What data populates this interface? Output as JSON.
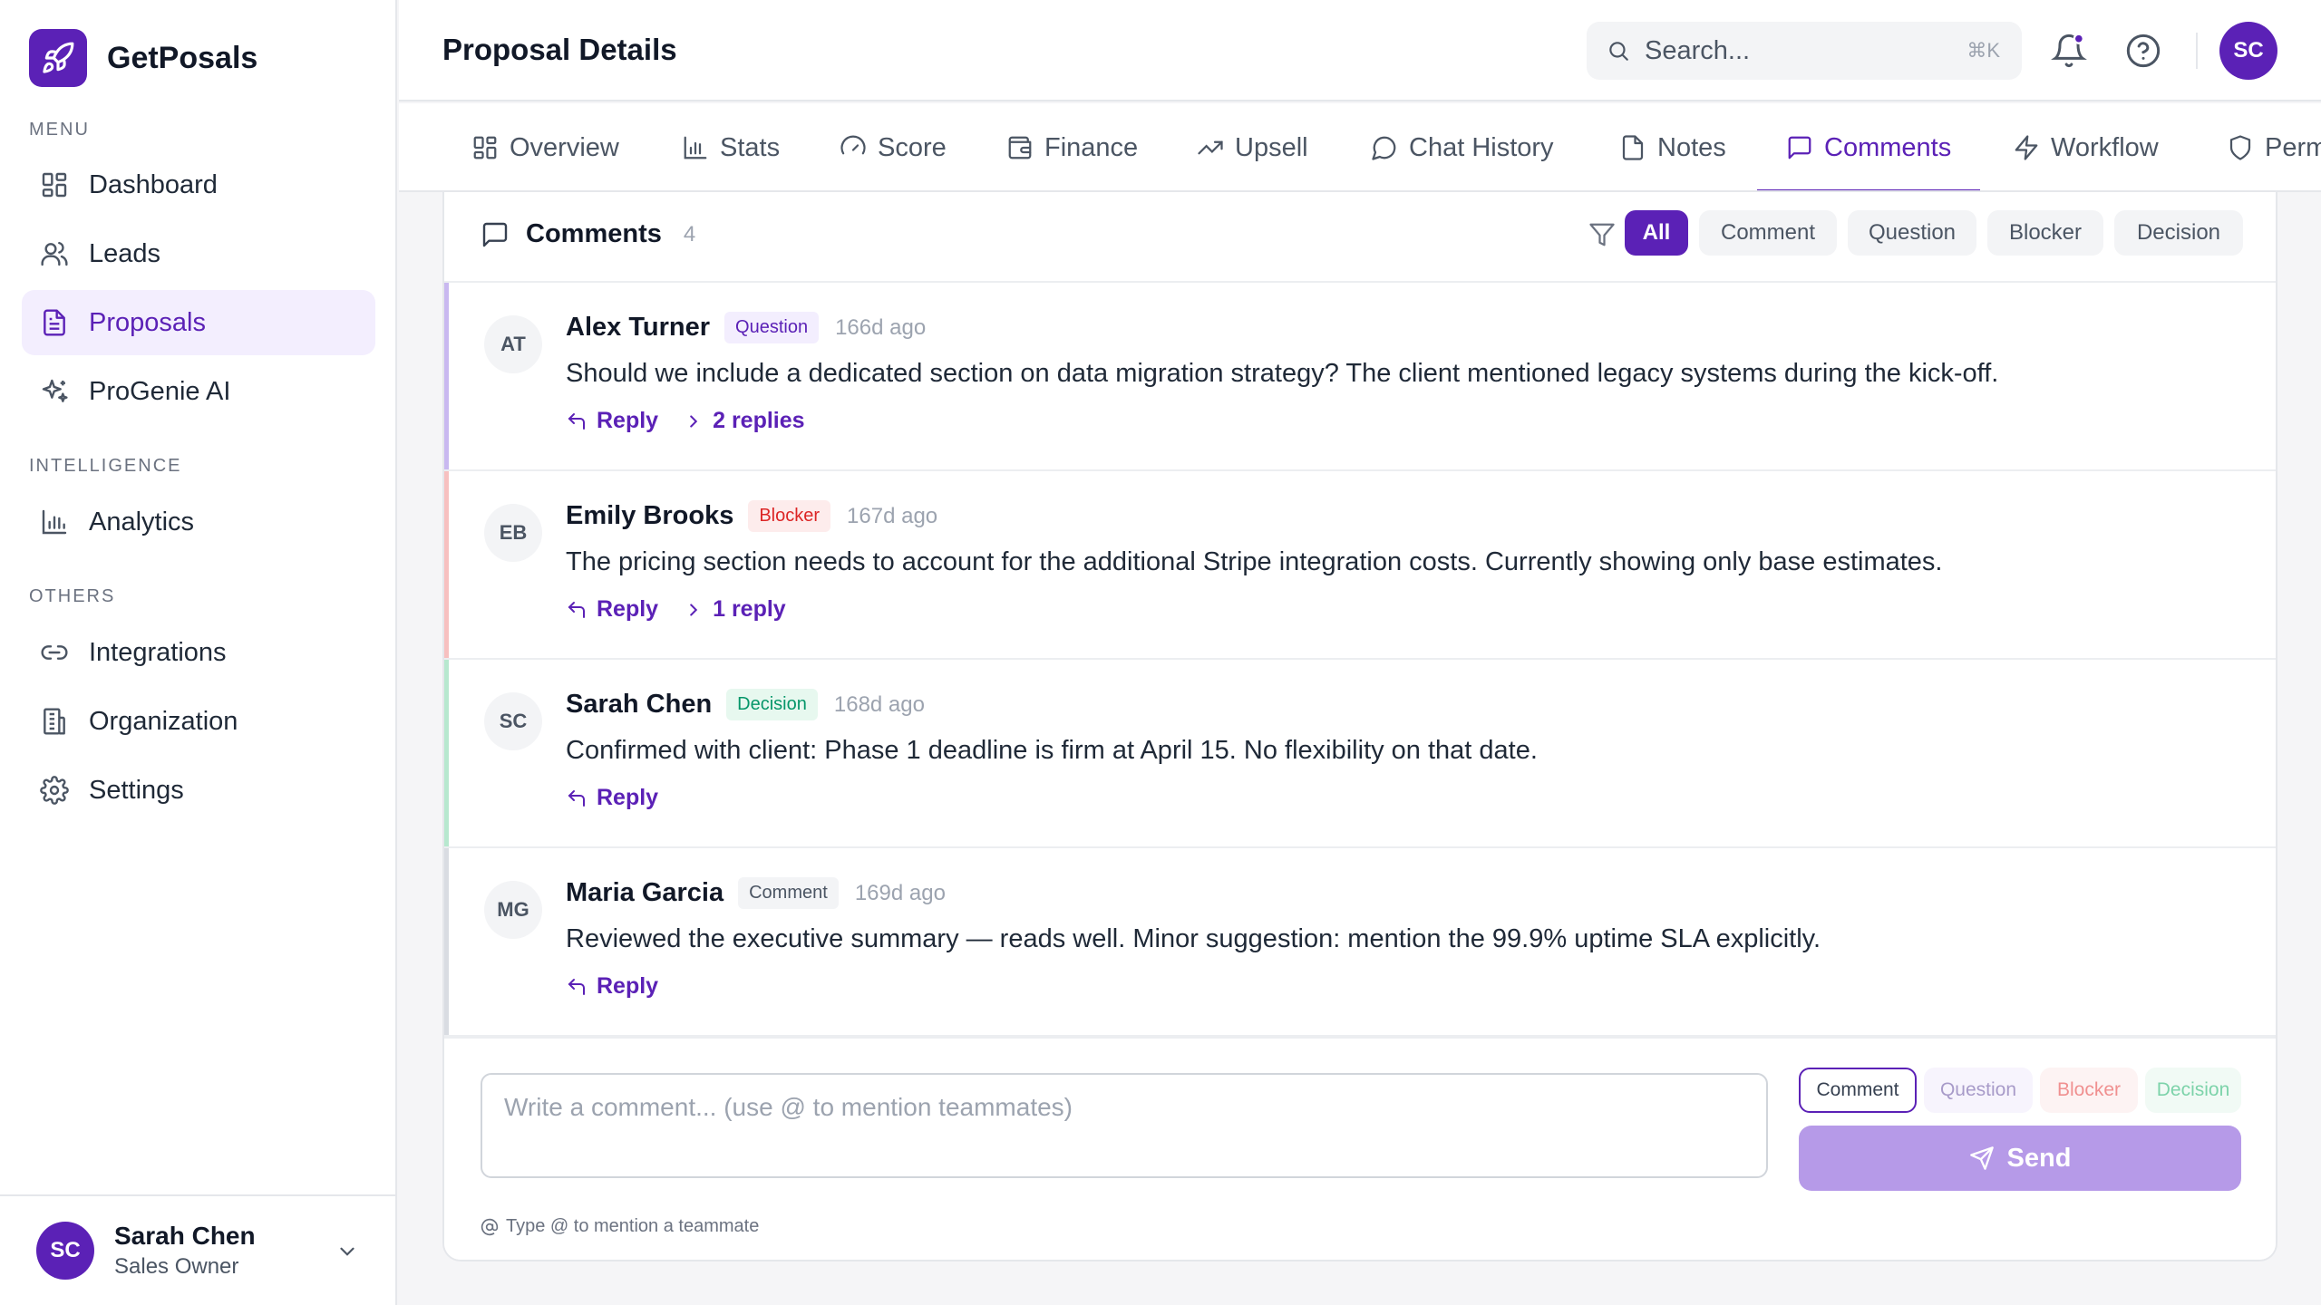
{
  "brand": {
    "name": "GetPosals"
  },
  "sidebar": {
    "sections": {
      "menu": "MENU",
      "intelligence": "INTELLIGENCE",
      "others": "OTHERS"
    },
    "items": [
      {
        "label": "Dashboard",
        "icon": "grid-icon"
      },
      {
        "label": "Leads",
        "icon": "users-icon"
      },
      {
        "label": "Proposals",
        "icon": "document-icon",
        "active": true
      },
      {
        "label": "ProGenie AI",
        "icon": "sparkles-icon"
      },
      {
        "label": "Analytics",
        "icon": "bar-chart-icon"
      },
      {
        "label": "Integrations",
        "icon": "link-icon"
      },
      {
        "label": "Organization",
        "icon": "building-icon"
      },
      {
        "label": "Settings",
        "icon": "gear-icon"
      }
    ],
    "user": {
      "initials": "SC",
      "name": "Sarah Chen",
      "role": "Sales Owner"
    }
  },
  "header": {
    "title": "Proposal Details",
    "search_placeholder": "Search...",
    "search_shortcut": "⌘K",
    "avatar_initials": "SC"
  },
  "tabs": [
    {
      "label": "Overview"
    },
    {
      "label": "Stats"
    },
    {
      "label": "Score"
    },
    {
      "label": "Finance"
    },
    {
      "label": "Upsell"
    },
    {
      "label": "Chat History"
    },
    {
      "label": "Notes"
    },
    {
      "label": "Comments",
      "active": true
    },
    {
      "label": "Workflow"
    },
    {
      "label": "Permissions"
    }
  ],
  "comments_panel": {
    "title": "Comments",
    "count": "4",
    "filters": [
      "All",
      "Comment",
      "Question",
      "Blocker",
      "Decision"
    ],
    "active_filter": "All",
    "items": [
      {
        "initials": "AT",
        "author": "Alex Turner",
        "type": "Question",
        "time": "166d ago",
        "text": "Should we include a dedicated section on data migration strategy? The client mentioned legacy systems during the kick-off.",
        "reply_label": "Reply",
        "replies_label": "2 replies"
      },
      {
        "initials": "EB",
        "author": "Emily Brooks",
        "type": "Blocker",
        "time": "167d ago",
        "text": "The pricing section needs to account for the additional Stripe integration costs. Currently showing only base estimates.",
        "reply_label": "Reply",
        "replies_label": "1 reply"
      },
      {
        "initials": "SC",
        "author": "Sarah Chen",
        "type": "Decision",
        "time": "168d ago",
        "text": "Confirmed with client: Phase 1 deadline is firm at April 15. No flexibility on that date.",
        "reply_label": "Reply"
      },
      {
        "initials": "MG",
        "author": "Maria Garcia",
        "type": "Comment",
        "time": "169d ago",
        "text": "Reviewed the executive summary — reads well. Minor suggestion: mention the 99.9% uptime SLA explicitly.",
        "reply_label": "Reply"
      }
    ],
    "composer": {
      "placeholder": "Write a comment... (use @ to mention teammates)",
      "value": "",
      "types": [
        "Comment",
        "Question",
        "Blocker",
        "Decision"
      ],
      "selected_type": "Comment",
      "send_label": "Send",
      "hint": "Type @ to mention a teammate"
    }
  },
  "colors": {
    "accent": "#5b21b6",
    "question": "#5b21b6",
    "blocker": "#dc2626",
    "decision": "#059669",
    "comment": "#4b5563"
  }
}
